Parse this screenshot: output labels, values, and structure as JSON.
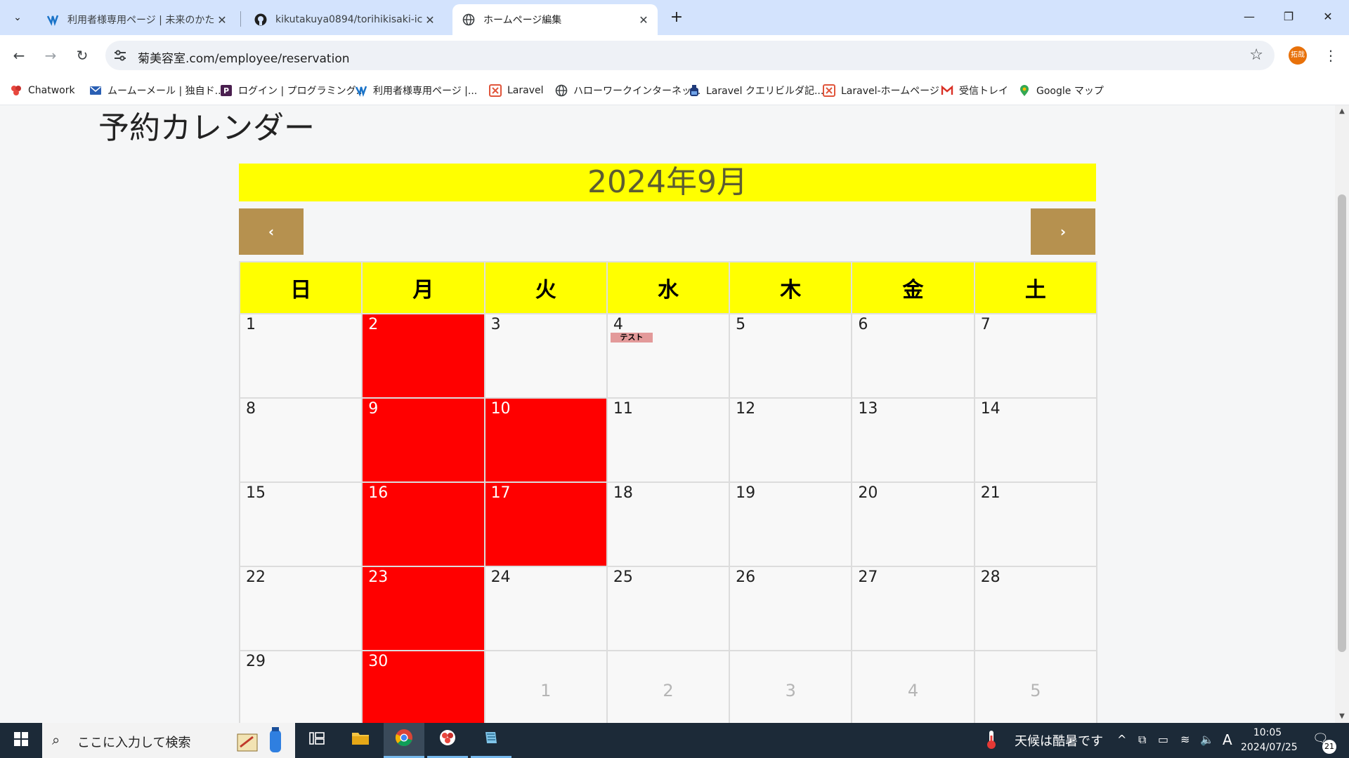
{
  "browser": {
    "tabs": [
      {
        "title": "利用者様専用ページ | 未来のかたち",
        "icon": "site-logo-icon",
        "active": false
      },
      {
        "title": "kikutakuya0894/torihikisaki-ichi",
        "icon": "github-icon",
        "active": false
      },
      {
        "title": "ホームページ編集",
        "icon": "globe-icon",
        "active": true
      }
    ],
    "address": "菊美容室.com/employee/reservation",
    "profile_label": "拓哉",
    "bookmarks": [
      {
        "label": "Chatwork",
        "icon": "chatwork-icon"
      },
      {
        "label": "ムームーメール | 独自ド...",
        "icon": "mail-icon"
      },
      {
        "label": "ログイン | プログラミング...",
        "icon": "p-logo-icon"
      },
      {
        "label": "利用者様専用ページ |...",
        "icon": "site-logo-icon"
      },
      {
        "label": "Laravel",
        "icon": "laravel-icon"
      },
      {
        "label": "ハローワークインターネッ...",
        "icon": "globe-icon"
      },
      {
        "label": "Laravel クエリビルダ記...",
        "icon": "bottle-icon"
      },
      {
        "label": "Laravel-ホームページ",
        "icon": "laravel-icon"
      },
      {
        "label": "受信トレイ",
        "icon": "gmail-icon"
      },
      {
        "label": "Google マップ",
        "icon": "maps-pin-icon"
      }
    ]
  },
  "page": {
    "title": "予約カレンダー",
    "month": "2024年9月",
    "prev_label": "‹",
    "next_label": "›",
    "weekdays": [
      "日",
      "月",
      "火",
      "水",
      "木",
      "金",
      "土"
    ],
    "weeks": [
      [
        {
          "day": "1"
        },
        {
          "day": "2",
          "closed": true
        },
        {
          "day": "3"
        },
        {
          "day": "4",
          "event": "テスト"
        },
        {
          "day": "5"
        },
        {
          "day": "6"
        },
        {
          "day": "7"
        }
      ],
      [
        {
          "day": "8"
        },
        {
          "day": "9",
          "closed": true
        },
        {
          "day": "10",
          "closed": true
        },
        {
          "day": "11"
        },
        {
          "day": "12"
        },
        {
          "day": "13"
        },
        {
          "day": "14"
        }
      ],
      [
        {
          "day": "15"
        },
        {
          "day": "16",
          "closed": true
        },
        {
          "day": "17",
          "closed": true
        },
        {
          "day": "18"
        },
        {
          "day": "19"
        },
        {
          "day": "20"
        },
        {
          "day": "21"
        }
      ],
      [
        {
          "day": "22"
        },
        {
          "day": "23",
          "closed": true
        },
        {
          "day": "24"
        },
        {
          "day": "25"
        },
        {
          "day": "26"
        },
        {
          "day": "27"
        },
        {
          "day": "28"
        }
      ],
      [
        {
          "day": "29"
        },
        {
          "day": "30",
          "closed": true
        },
        {
          "day": "1",
          "other": true
        },
        {
          "day": "2",
          "other": true
        },
        {
          "day": "3",
          "other": true
        },
        {
          "day": "4",
          "other": true
        },
        {
          "day": "5",
          "other": true
        }
      ]
    ],
    "colors": {
      "banner": "#ffff00",
      "closed": "#ff0000",
      "nav": "#b6914f",
      "event": "#e39a9a"
    }
  },
  "taskbar": {
    "search_placeholder": "ここに入力して検索",
    "weather": "天候は酷暑です",
    "time": "10:05",
    "date": "2024/07/25",
    "notifications": "21",
    "ime": "A"
  }
}
